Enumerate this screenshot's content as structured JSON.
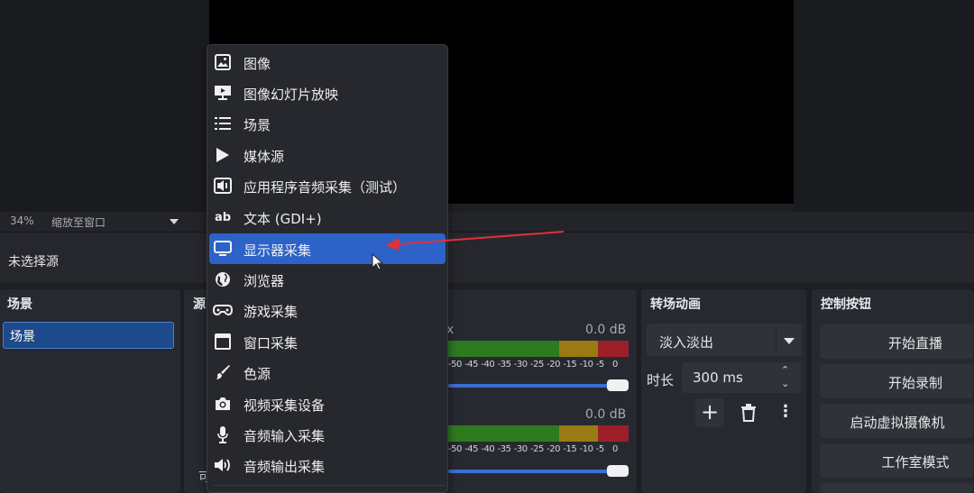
{
  "preview": {
    "zoom_level": "34%",
    "zoom_mode": "缩放至窗口"
  },
  "source_status": "未选择源",
  "scenes": {
    "title": "场景",
    "items": [
      "场景"
    ]
  },
  "sources": {
    "title_fragment": "源",
    "bottom_fragment": "可"
  },
  "context_menu": {
    "items": [
      {
        "label": "图像",
        "icon": "image-icon"
      },
      {
        "label": "图像幻灯片放映",
        "icon": "slideshow-icon"
      },
      {
        "label": "场景",
        "icon": "list-icon"
      },
      {
        "label": "媒体源",
        "icon": "play-icon"
      },
      {
        "label": "应用程序音频采集（测试）",
        "icon": "app-audio-icon"
      },
      {
        "label": "文本 (GDI+)",
        "icon": "text-icon"
      },
      {
        "label": "显示器采集",
        "icon": "monitor-icon",
        "highlighted": true
      },
      {
        "label": "浏览器",
        "icon": "globe-icon"
      },
      {
        "label": "游戏采集",
        "icon": "gamepad-icon"
      },
      {
        "label": "窗口采集",
        "icon": "window-icon"
      },
      {
        "label": "色源",
        "icon": "brush-icon"
      },
      {
        "label": "视频采集设备",
        "icon": "camera-icon"
      },
      {
        "label": "音频输入采集",
        "icon": "microphone-icon"
      },
      {
        "label": "音频输出采集",
        "icon": "speaker-icon"
      }
    ]
  },
  "mixer": {
    "tracks": [
      {
        "name_fragment": "x",
        "db": "0.0 dB",
        "volume": 1.0
      },
      {
        "name_fragment": "",
        "db": "0.0 dB",
        "volume": 1.0
      }
    ],
    "scale": [
      "-50",
      "-45",
      "-40",
      "-35",
      "-30",
      "-25",
      "-20",
      "-15",
      "-10",
      "-5",
      "0"
    ]
  },
  "transitions": {
    "title": "转场动画",
    "selected": "淡入淡出",
    "duration_label": "时长",
    "duration_value": "300 ms",
    "add_symbol": "+",
    "more_symbol": "⋮"
  },
  "controls": {
    "title": "控制按钮",
    "buttons": [
      "开始直播",
      "开始录制",
      "启动虚拟摄像机",
      "工作室模式"
    ]
  },
  "colors": {
    "accent": "#2d63c8",
    "annotation_arrow": "#e0303a"
  }
}
